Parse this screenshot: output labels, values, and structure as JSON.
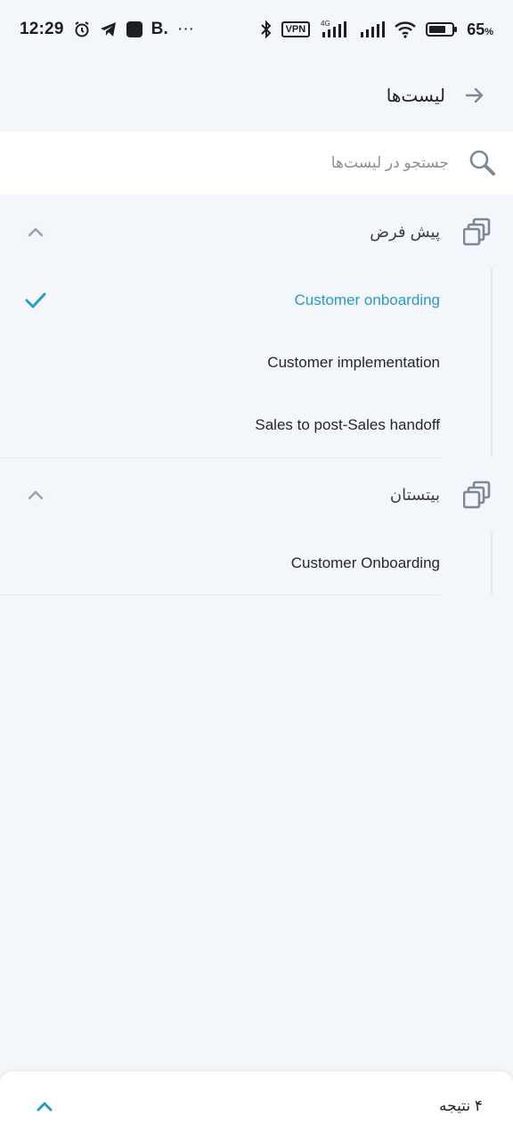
{
  "status_bar": {
    "time": "12:29",
    "app_letter": "B.",
    "more": "···",
    "vpn": "VPN",
    "network": "4G",
    "battery_percent": "65",
    "battery_unit": "%"
  },
  "header": {
    "title": "لیست‌ها",
    "back_icon": "arrow-right-icon"
  },
  "search": {
    "placeholder": "جستجو در لیست‌ها",
    "value": ""
  },
  "groups": [
    {
      "title": "پیش فرض",
      "expanded": true,
      "items": [
        {
          "label": "Customer onboarding",
          "selected": true
        },
        {
          "label": "Customer implementation",
          "selected": false
        },
        {
          "label": "Sales to post-Sales handoff",
          "selected": false
        }
      ]
    },
    {
      "title": "بیتستان",
      "expanded": true,
      "items": [
        {
          "label": "Customer Onboarding",
          "selected": false
        }
      ]
    }
  ],
  "footer": {
    "result_count": "۴ نتیجه"
  },
  "colors": {
    "accent": "#2a9bc4",
    "background": "#f3f6fb",
    "icon_gray": "#7c8894"
  }
}
